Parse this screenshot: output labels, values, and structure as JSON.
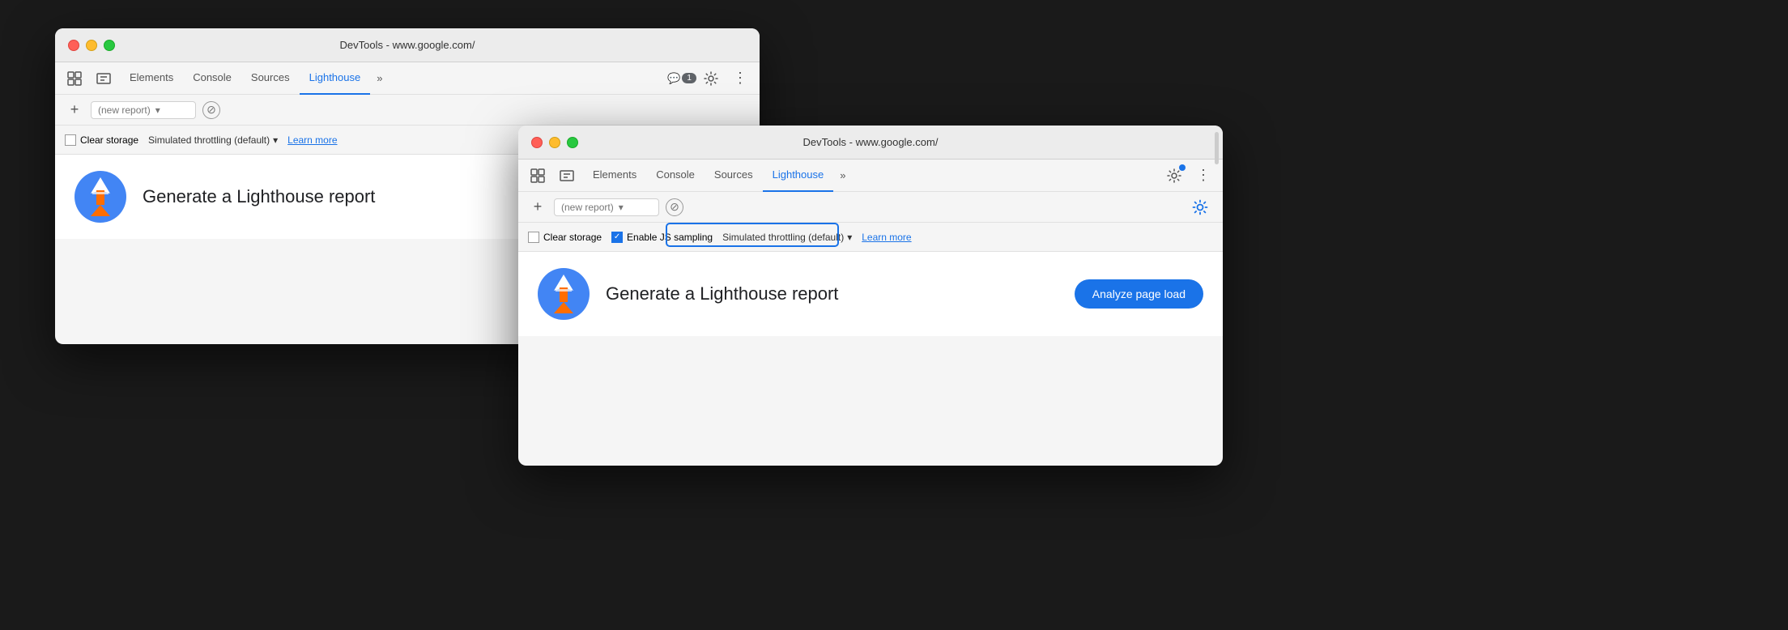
{
  "window_back": {
    "title": "DevTools - www.google.com/",
    "tabs": [
      "Elements",
      "Console",
      "Sources",
      "Lighthouse"
    ],
    "active_tab": "Lighthouse",
    "report_placeholder": "(new report)",
    "options": {
      "clear_storage": "Clear storage",
      "throttling": "Simulated throttling (default)",
      "learn_more": "Learn more"
    },
    "main": {
      "generate_text": "Generate a Lighthouse report"
    }
  },
  "window_front": {
    "title": "DevTools - www.google.com/",
    "tabs": [
      "Elements",
      "Console",
      "Sources",
      "Lighthouse"
    ],
    "active_tab": "Lighthouse",
    "report_placeholder": "(new report)",
    "options": {
      "clear_storage": "Clear storage",
      "enable_js": "Enable JS sampling",
      "throttling": "Simulated throttling (default)",
      "learn_more": "Learn more"
    },
    "main": {
      "generate_text": "Generate a Lighthouse report",
      "analyze_btn": "Analyze page load"
    }
  },
  "icons": {
    "elements": "⋮⋮",
    "more": "»",
    "settings": "⚙",
    "more_vert": "⋮",
    "chat": "💬",
    "chevron_down": "▾",
    "checkmark": "✓"
  }
}
